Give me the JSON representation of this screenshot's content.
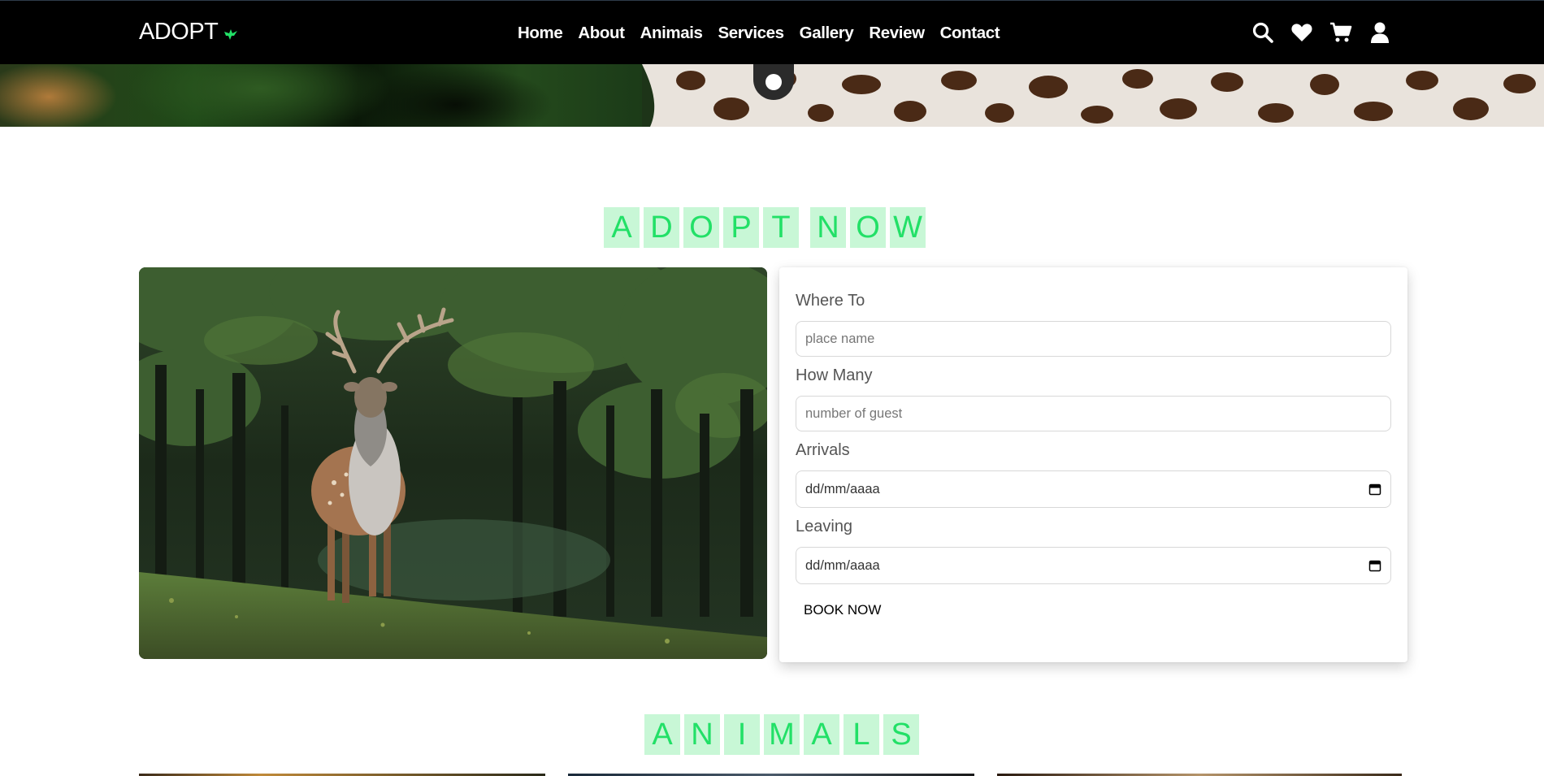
{
  "navbar": {
    "logo_text": "ADOPT",
    "logo_icon": "bird-icon",
    "links": [
      "Home",
      "About",
      "Animais",
      "Services",
      "Gallery",
      "Review",
      "Contact"
    ],
    "icons": [
      "search-icon",
      "heart-icon",
      "cart-icon",
      "user-icon"
    ]
  },
  "adopt_section": {
    "title_letters": [
      "A",
      "D",
      "O",
      "P",
      "T",
      "N",
      "O",
      "W"
    ],
    "form": {
      "where_to_label": "Where To",
      "where_to_placeholder": "place name",
      "how_many_label": "How Many",
      "how_many_placeholder": "number of guest",
      "arrivals_label": "Arrivals",
      "arrivals_value": "dd/mm/aaaa",
      "leaving_label": "Leaving",
      "leaving_value": "dd/mm/aaaa",
      "book_button": "BOOK NOW"
    }
  },
  "animals_section": {
    "title_letters": [
      "A",
      "N",
      "I",
      "M",
      "A",
      "L",
      "S"
    ]
  },
  "colors": {
    "heading_bg": "#c8f7d6",
    "heading_text": "#22e067",
    "navbar_bg": "#000000",
    "logo_accent": "#22e067"
  }
}
